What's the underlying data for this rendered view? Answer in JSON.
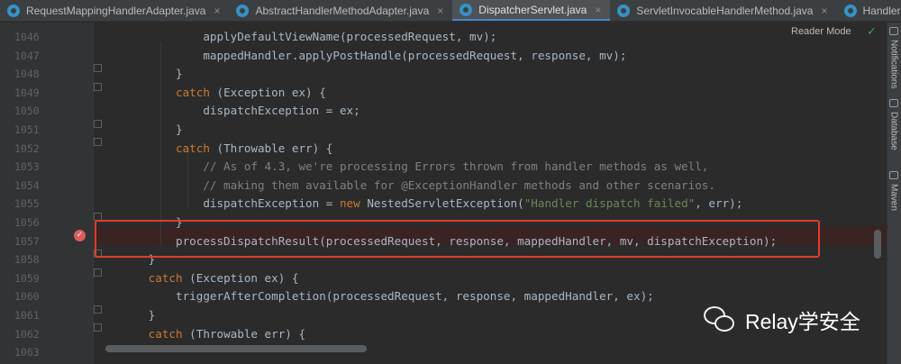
{
  "tabs": [
    {
      "label": "RequestMappingHandlerAdapter.java",
      "active": false,
      "close": "×"
    },
    {
      "label": "AbstractHandlerMethodAdapter.java",
      "active": false,
      "close": "×"
    },
    {
      "label": "DispatcherServlet.java",
      "active": true,
      "close": "×"
    },
    {
      "label": "ServletInvocableHandlerMethod.java",
      "active": false,
      "close": "×"
    },
    {
      "label": "HandlerMe",
      "active": false,
      "close": ""
    }
  ],
  "line_numbers": [
    "1046",
    "1047",
    "1048",
    "1049",
    "1050",
    "1051",
    "1052",
    "1053",
    "1054",
    "1055",
    "1056",
    "1057",
    "1058",
    "1059",
    "1060",
    "1061",
    "1062",
    "1063"
  ],
  "code_lines": [
    [
      {
        "c": "pl",
        "t": "                applyDefaultViewName(processedRequest, mv);"
      }
    ],
    [
      {
        "c": "pl",
        "t": "                mappedHandler.applyPostHandle(processedRequest, response, mv);"
      }
    ],
    [
      {
        "c": "pl",
        "t": "            }"
      }
    ],
    [
      {
        "c": "kw",
        "t": "            catch "
      },
      {
        "c": "pl",
        "t": "(Exception ex) {"
      }
    ],
    [
      {
        "c": "pl",
        "t": "                dispatchException = ex;"
      }
    ],
    [
      {
        "c": "pl",
        "t": "            }"
      }
    ],
    [
      {
        "c": "kw",
        "t": "            catch "
      },
      {
        "c": "pl",
        "t": "(Throwable err) {"
      }
    ],
    [
      {
        "c": "cm",
        "t": "                // As of 4.3, we're processing Errors thrown from handler methods as well,"
      }
    ],
    [
      {
        "c": "cm",
        "t": "                // making them available for @ExceptionHandler methods and other scenarios."
      }
    ],
    [
      {
        "c": "pl",
        "t": "                dispatchException = "
      },
      {
        "c": "kw",
        "t": "new "
      },
      {
        "c": "pl",
        "t": "NestedServletException("
      },
      {
        "c": "st",
        "t": "\"Handler dispatch failed\""
      },
      {
        "c": "pl",
        "t": ", err);"
      }
    ],
    [
      {
        "c": "pl",
        "t": "            }"
      }
    ],
    [
      {
        "c": "pl",
        "t": "            processDispatchResult(processedRequest, response, mappedHandler, mv, dispatchException);"
      }
    ],
    [
      {
        "c": "pl",
        "t": "        }"
      }
    ],
    [
      {
        "c": "kw",
        "t": "        catch "
      },
      {
        "c": "pl",
        "t": "(Exception ex) {"
      }
    ],
    [
      {
        "c": "pl",
        "t": "            triggerAfterCompletion(processedRequest, response, mappedHandler, ex);"
      }
    ],
    [
      {
        "c": "pl",
        "t": "        }"
      }
    ],
    [
      {
        "c": "kw",
        "t": "        catch "
      },
      {
        "c": "pl",
        "t": "(Throwable err) {"
      }
    ],
    [
      {
        "c": "pl",
        "t": ""
      }
    ]
  ],
  "breakpoint_symbol": "✓",
  "reader_mode": "Reader Mode",
  "check_icon": "✓",
  "right_panels": [
    "Notifications",
    "Database",
    "Maven"
  ],
  "watermark": "Relay学安全",
  "colors": {
    "keyword": "#cc7832",
    "comment": "#808080",
    "string": "#6a8759",
    "plain": "#a9b7c6",
    "highlight_box": "#e23b2e"
  }
}
